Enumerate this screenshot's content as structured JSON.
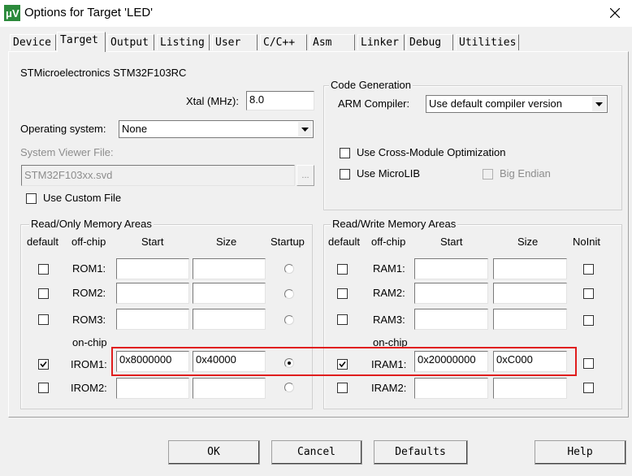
{
  "window": {
    "title": "Options for Target 'LED'"
  },
  "tabs": [
    {
      "label": "Device"
    },
    {
      "label": "Target"
    },
    {
      "label": "Output"
    },
    {
      "label": "Listing"
    },
    {
      "label": "User"
    },
    {
      "label": "C/C++"
    },
    {
      "label": "Asm"
    },
    {
      "label": "Linker"
    },
    {
      "label": "Debug"
    },
    {
      "label": "Utilities"
    }
  ],
  "active_tab": "Target",
  "target": {
    "device_name": "STMicroelectronics STM32F103RC",
    "xtal_label": "Xtal (MHz):",
    "xtal_value": "8.0",
    "os_label": "Operating system:",
    "os_value": "None",
    "svd_label": "System Viewer File:",
    "svd_value": "STM32F103xx.svd",
    "svd_browse": "...",
    "custom_file_label": "Use Custom File",
    "custom_file_checked": false
  },
  "code_generation": {
    "title": "Code Generation",
    "compiler_label": "ARM Compiler:",
    "compiler_value": "Use default compiler version",
    "cross_module_label": "Use Cross-Module Optimization",
    "microlib_label": "Use MicroLIB",
    "big_endian_label": "Big Endian"
  },
  "rom": {
    "title": "Read/Only Memory Areas",
    "headers": {
      "default": "default",
      "offchip": "off-chip",
      "start": "Start",
      "size": "Size",
      "startup": "Startup"
    },
    "onchip_label": "on-chip",
    "rows": [
      {
        "name": "ROM1:",
        "start": "",
        "size": "",
        "default": false,
        "startup": false
      },
      {
        "name": "ROM2:",
        "start": "",
        "size": "",
        "default": false,
        "startup": false
      },
      {
        "name": "ROM3:",
        "start": "",
        "size": "",
        "default": false,
        "startup": false
      },
      {
        "name": "IROM1:",
        "start": "0x8000000",
        "size": "0x40000",
        "default": true,
        "startup": true
      },
      {
        "name": "IROM2:",
        "start": "",
        "size": "",
        "default": false,
        "startup": false
      }
    ]
  },
  "ram": {
    "title": "Read/Write Memory Areas",
    "headers": {
      "default": "default",
      "offchip": "off-chip",
      "start": "Start",
      "size": "Size",
      "noinit": "NoInit"
    },
    "onchip_label": "on-chip",
    "rows": [
      {
        "name": "RAM1:",
        "start": "",
        "size": "",
        "default": false,
        "noinit": false
      },
      {
        "name": "RAM2:",
        "start": "",
        "size": "",
        "default": false,
        "noinit": false
      },
      {
        "name": "RAM3:",
        "start": "",
        "size": "",
        "default": false,
        "noinit": false
      },
      {
        "name": "IRAM1:",
        "start": "0x20000000",
        "size": "0xC000",
        "default": true,
        "noinit": false
      },
      {
        "name": "IRAM2:",
        "start": "",
        "size": "",
        "default": false,
        "noinit": false
      }
    ]
  },
  "buttons": {
    "ok": "OK",
    "cancel": "Cancel",
    "defaults": "Defaults",
    "help": "Help"
  },
  "colors": {
    "highlight": "#e01d1d",
    "background": "#f0f0f0"
  },
  "icons": {
    "app": "keil-uvision-icon",
    "close": "close-icon",
    "dropdown": "chevron-down-icon",
    "check": "checkmark-icon"
  }
}
